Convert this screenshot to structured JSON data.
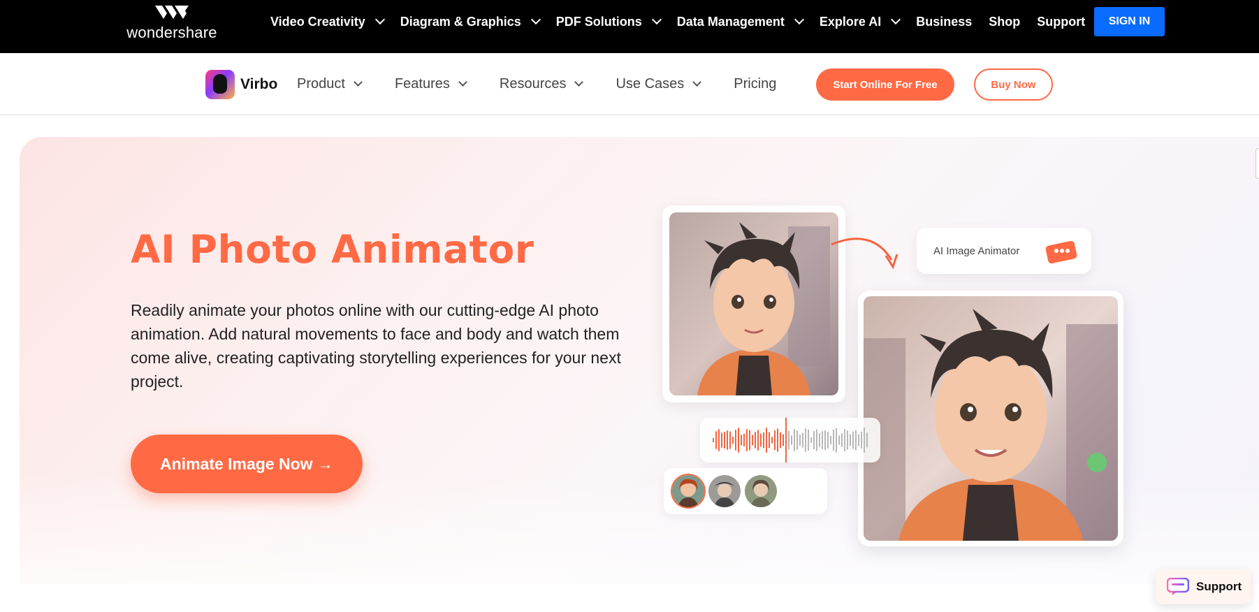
{
  "brand": {
    "name": "wondershare"
  },
  "topnav": {
    "items": [
      {
        "label": "Video Creativity",
        "dropdown": true
      },
      {
        "label": "Diagram & Graphics",
        "dropdown": true
      },
      {
        "label": "PDF Solutions",
        "dropdown": true
      },
      {
        "label": "Data Management",
        "dropdown": true
      },
      {
        "label": "Explore AI",
        "dropdown": true
      },
      {
        "label": "Business",
        "dropdown": false
      },
      {
        "label": "Shop",
        "dropdown": false
      },
      {
        "label": "Support",
        "dropdown": false
      }
    ],
    "signin_label": "SIGN IN"
  },
  "product": {
    "name": "Virbo",
    "nav": [
      {
        "label": "Product",
        "dropdown": true
      },
      {
        "label": "Features",
        "dropdown": true
      },
      {
        "label": "Resources",
        "dropdown": true
      },
      {
        "label": "Use Cases",
        "dropdown": true
      },
      {
        "label": "Pricing",
        "dropdown": false
      }
    ],
    "start_label": "Start Online For Free",
    "buy_label": "Buy Now"
  },
  "hero": {
    "title": "AI Photo Animator",
    "description": "Readily animate your photos online with our cutting-edge AI photo animation. Add natural movements to face and body and watch them come alive, creating captivating storytelling experiences for your next project.",
    "cta_label": "Animate Image Now →",
    "illustration": {
      "pill_label": "AI Image Animator"
    }
  },
  "support_widget": {
    "label": "Support"
  },
  "colors": {
    "accent": "#ff6a45",
    "signin_blue": "#0a6cff",
    "topbar_bg": "#000000"
  }
}
